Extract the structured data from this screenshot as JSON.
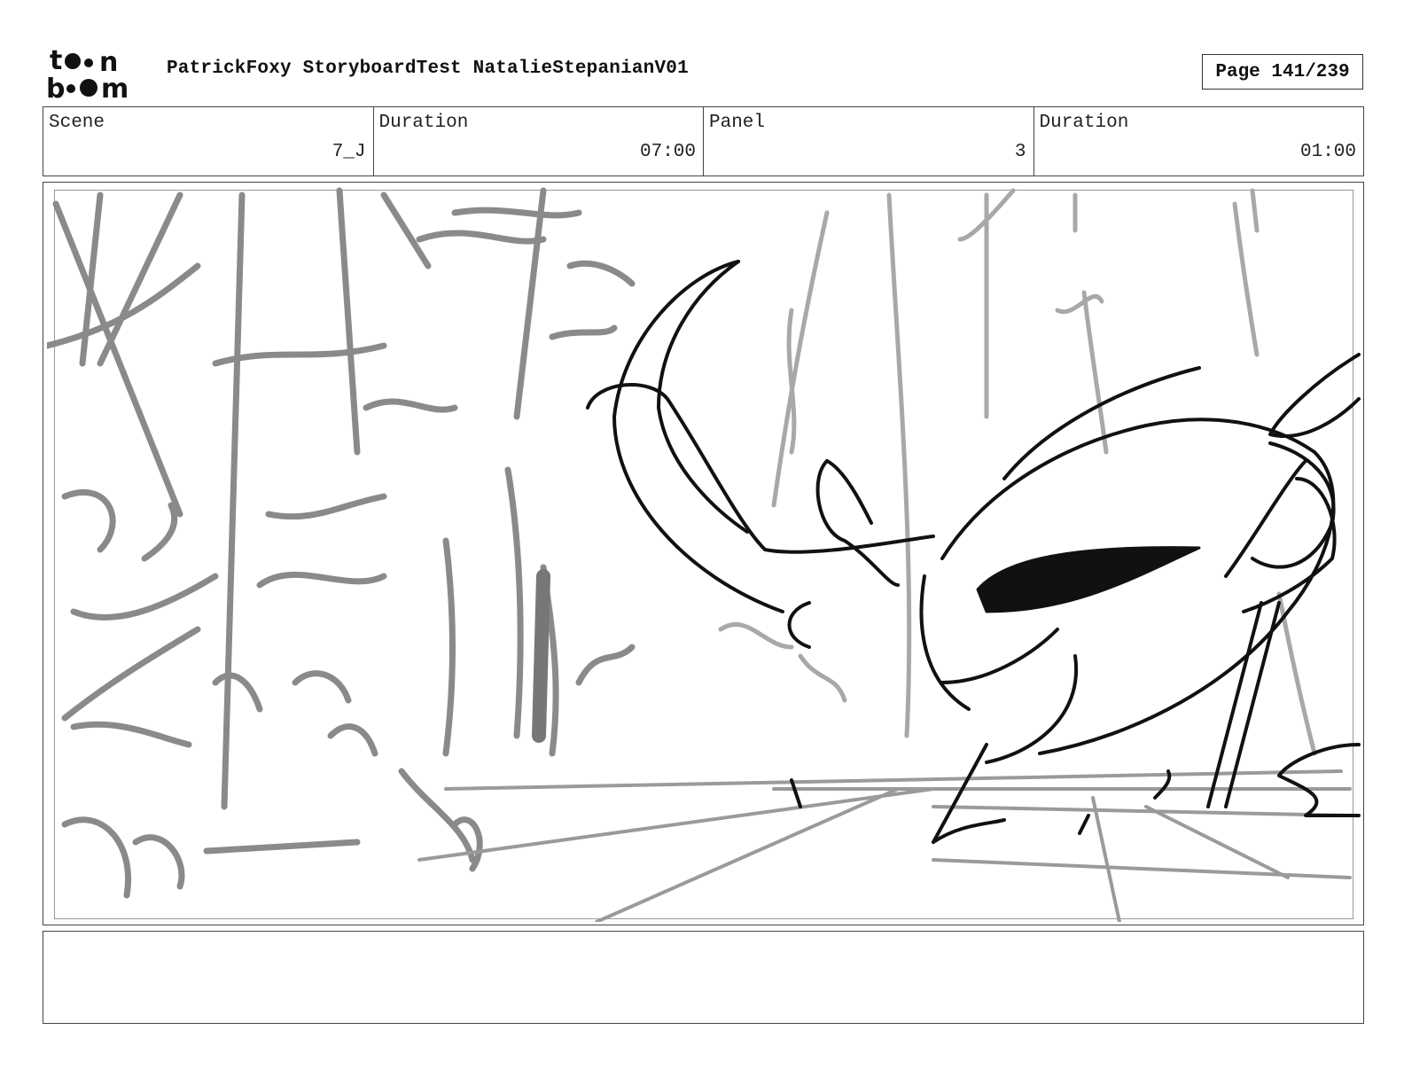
{
  "header": {
    "logo_top": "t●●n",
    "logo_bottom": "b●●m",
    "title": "PatrickFoxy StoryboardTest NatalieStepanianV01",
    "page": "Page 141/239"
  },
  "info": {
    "scene_label": "Scene",
    "scene_value": "7_J",
    "scene_duration_label": "Duration",
    "scene_duration_value": "07:00",
    "panel_label": "Panel",
    "panel_value": "3",
    "panel_duration_label": "Duration",
    "panel_duration_value": "01:00"
  },
  "panel_image": {
    "description_icon": "sketch-drawing"
  },
  "notes": {
    "text": ""
  }
}
